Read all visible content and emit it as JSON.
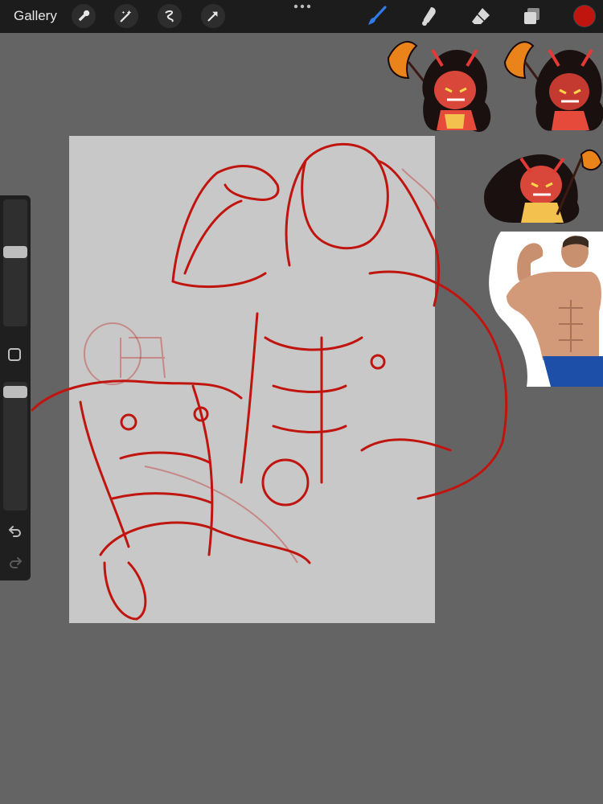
{
  "topbar": {
    "gallery_label": "Gallery",
    "left_tools": [
      "wrench-icon",
      "magic-wand-icon",
      "selection-icon",
      "transform-arrow-icon"
    ],
    "right_tools": [
      "brush-icon",
      "smudge-icon",
      "eraser-icon",
      "layers-icon"
    ],
    "current_color": "#c0150f",
    "active_tool_color": "#2f7be8"
  },
  "sidebar": {
    "brush_size_level": 0.55,
    "opacity_level": 0.95
  },
  "canvas": {
    "background": "#c8c8c8",
    "stroke_color": "#c0150f"
  }
}
